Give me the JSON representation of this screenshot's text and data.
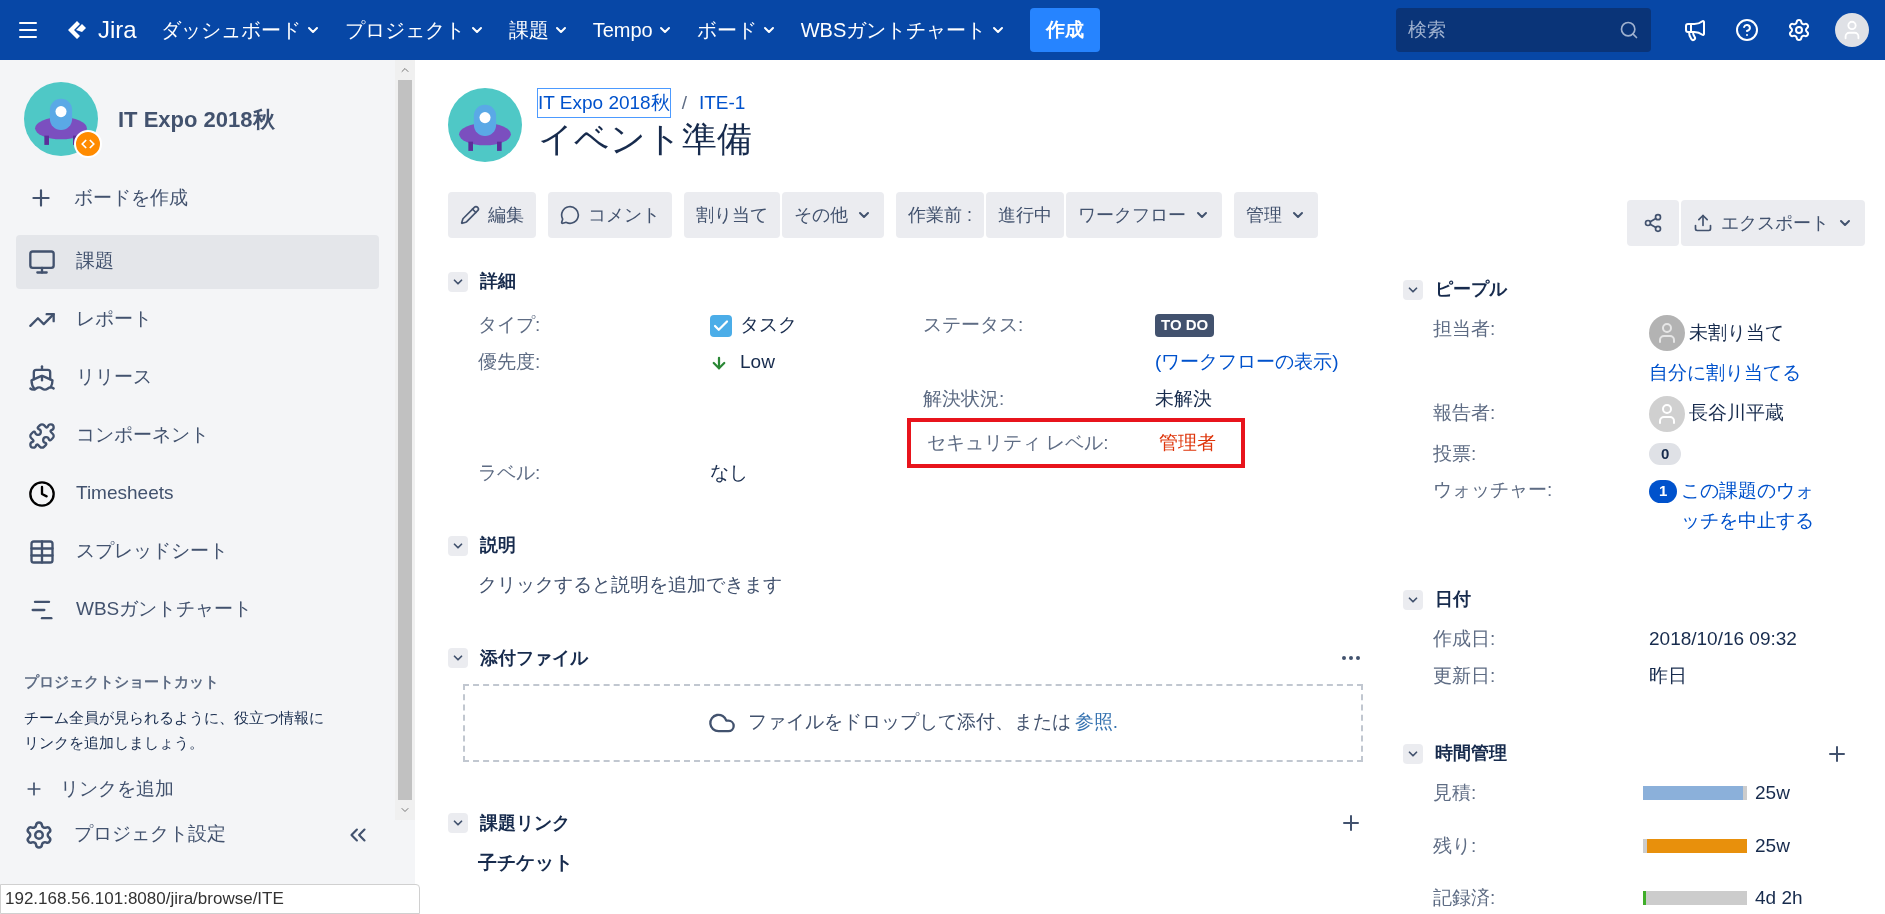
{
  "topnav": {
    "logo": "Jira",
    "menus": [
      {
        "label": "ダッシュボード"
      },
      {
        "label": "プロジェクト"
      },
      {
        "label": "課題"
      },
      {
        "label": "Tempo"
      },
      {
        "label": "ボード"
      },
      {
        "label": "WBSガントチャート"
      }
    ],
    "create_button": "作成",
    "search": {
      "placeholder": "検索"
    }
  },
  "sidebar": {
    "project_name": "IT Expo 2018秋",
    "create_board": "ボードを作成",
    "items": [
      {
        "label": "課題",
        "selected": true
      },
      {
        "label": "レポート",
        "selected": false
      },
      {
        "label": "リリース",
        "selected": false
      },
      {
        "label": "コンポーネント",
        "selected": false
      },
      {
        "label": "Timesheets",
        "selected": false
      },
      {
        "label": "スプレッドシート",
        "selected": false
      },
      {
        "label": "WBSガントチャート",
        "selected": false
      }
    ],
    "shortcuts_title": "プロジェクトショートカット",
    "shortcuts_text": "チーム全員が見られるように、役立つ情報にリンクを追加しましょう。",
    "add_link": "リンクを追加",
    "settings": "プロジェクト設定"
  },
  "issue": {
    "breadcrumb": [
      {
        "label": "IT Expo 2018秋",
        "focused": true
      },
      {
        "label": "ITE-1",
        "focused": false
      }
    ],
    "breadcrumb_separator": "/",
    "title": "イベント準備"
  },
  "toolbar": {
    "groups": [
      [
        {
          "label": "編集",
          "dropdown": false
        }
      ],
      [
        {
          "label": "コメント",
          "dropdown": false
        }
      ],
      [
        {
          "label": "割り当て",
          "dropdown": false
        },
        {
          "label": "その他",
          "dropdown": true
        }
      ],
      [
        {
          "label": "作業前 :",
          "dropdown": false
        },
        {
          "label": "進行中",
          "dropdown": false
        },
        {
          "label": "ワークフロー",
          "dropdown": true
        }
      ],
      [
        {
          "label": "管理",
          "dropdown": true
        }
      ]
    ],
    "export_button": "エクスポート"
  },
  "details": {
    "title": "詳細",
    "left": [
      {
        "label": "タイプ:",
        "value": "タスク",
        "kind": "type"
      },
      {
        "label": "優先度:",
        "value": "Low",
        "kind": "priority"
      },
      {
        "kind": "blank"
      },
      {
        "kind": "blank"
      },
      {
        "label": "ラベル:",
        "value": "なし",
        "kind": "text"
      }
    ],
    "right": [
      {
        "label": "ステータス:",
        "value": "TO DO",
        "kind": "status"
      },
      {
        "value": "(ワークフローの表示)",
        "kind": "link"
      },
      {
        "label": "解決状況:",
        "value": "未解決",
        "kind": "text"
      },
      {
        "label": "セキュリティ レベル:",
        "value": "管理者",
        "kind": "security",
        "highlighted": true
      }
    ]
  },
  "description": {
    "title": "説明",
    "placeholder": "クリックすると説明を追加できます"
  },
  "attachments": {
    "title": "添付ファイル",
    "drop_text": "ファイルをドロップして添付、または",
    "browse_link": "参照."
  },
  "issue_links": {
    "title": "課題リンク",
    "subheading": "子チケット"
  },
  "people": {
    "title": "ピープル",
    "assignee_label": "担当者:",
    "assignee": "未割り当て",
    "assign_me": "自分に割り当てる",
    "reporter_label": "報告者:",
    "reporter": "長谷川平蔵",
    "votes_label": "投票:",
    "votes": "0",
    "watchers_label": "ウォッチャー:",
    "watchers": "1",
    "watch_link": "この課題のウォッチを中止する"
  },
  "dates": {
    "title": "日付",
    "rows": [
      {
        "label": "作成日:",
        "value": "2018/10/16 09:32"
      },
      {
        "label": "更新日:",
        "value": "昨日"
      }
    ]
  },
  "time_tracking": {
    "title": "時間管理",
    "rows": [
      {
        "label": "見積:",
        "value": "25w",
        "level": 0.96,
        "color": "#8bb0da"
      },
      {
        "label": "残り:",
        "value": "25w",
        "level": 0.96,
        "color": "#e8900c"
      },
      {
        "label": "記録済:",
        "value": "4d 2h",
        "level": 0.03,
        "color": "#3fae29"
      }
    ]
  },
  "status_bar": "192.168.56.101:8080/jira/browse/ITE"
}
